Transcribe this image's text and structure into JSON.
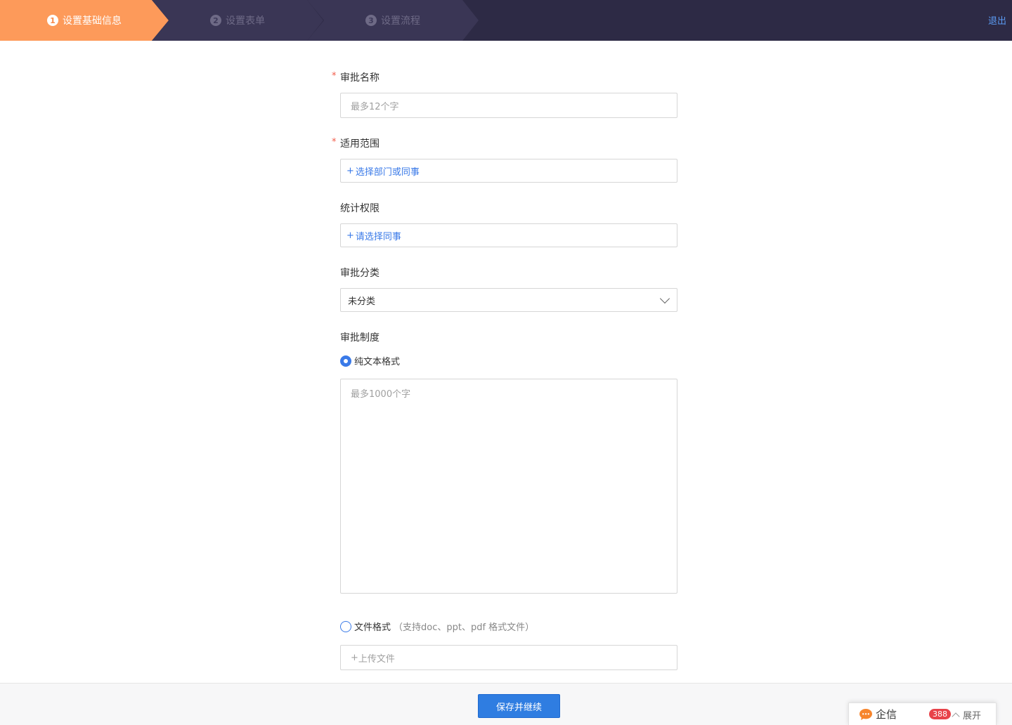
{
  "header": {
    "steps": [
      {
        "num": "1",
        "label": "设置基础信息"
      },
      {
        "num": "2",
        "label": "设置表单"
      },
      {
        "num": "3",
        "label": "设置流程"
      }
    ],
    "logout": "退出",
    "colors": {
      "active": "#fd9a5a",
      "bar": "#2d2a45"
    }
  },
  "form": {
    "name": {
      "label": "审批名称",
      "required": "*",
      "placeholder": "最多12个字"
    },
    "scope": {
      "label": "适用范围",
      "required": "*",
      "plus": "+",
      "link": "选择部门或同事"
    },
    "stats": {
      "label": "统计权限",
      "plus": "+",
      "link": "请选择同事"
    },
    "category": {
      "label": "审批分类",
      "value": "未分类"
    },
    "policy": {
      "label": "审批制度",
      "text_option": "纯文本格式",
      "text_placeholder": "最多1000个字",
      "file_option": "文件格式",
      "file_hint": "（支持doc、ppt、pdf 格式文件）",
      "upload_plus": "+",
      "upload_label": "上传文件"
    }
  },
  "footer": {
    "save_button": "保存并继续"
  },
  "chat": {
    "name": "企信",
    "badge": "388",
    "expand": "展开"
  }
}
